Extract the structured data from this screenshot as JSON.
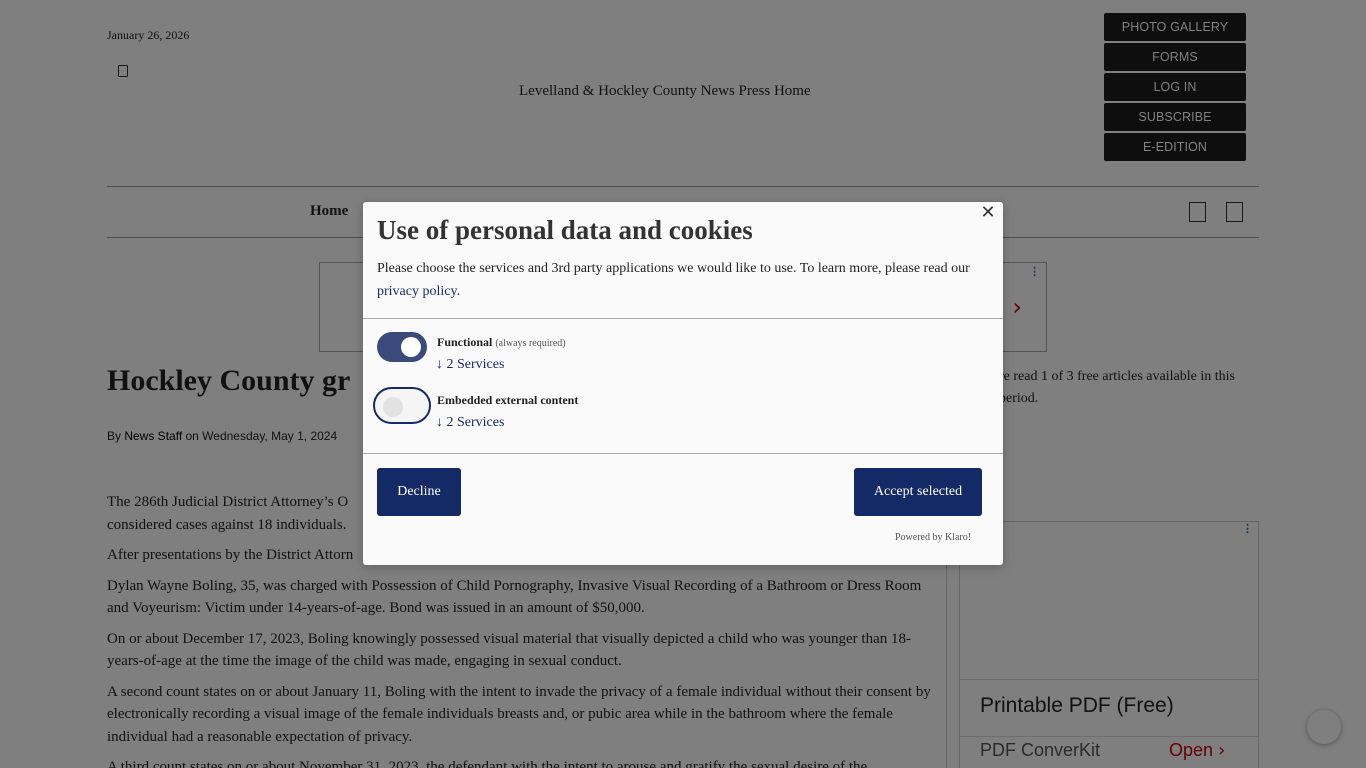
{
  "page": {
    "date": "January 26, 2026",
    "logo_alt": "Levelland & Hockley County News Press Home",
    "top_buttons": [
      "PHOTO GALLERY",
      "FORMS",
      "LOG IN",
      "SUBSCRIBE",
      "E-EDITION"
    ],
    "nav_home": "Home",
    "headline": "Hockley County gr",
    "byline_prefix": "By ",
    "byline_author": "News Staff",
    "byline_date": " on Wednesday, May 1, 2024",
    "free_articles_note": "re read 1 of 3 free articles available in this period.",
    "paragraphs": [
      "The 286th Judicial District Attorney’s O",
      "considered cases against 18 individuals.",
      "After presentations by the District Attorn",
      "Dylan Wayne Boling, 35, was charged with Possession of Child Pornography, Invasive Visual Recording of a Bathroom or Dress Room and Voyeurism: Victim under 14-years-of-age. Bond was issued in an amount of $50,000.",
      "On or about December 17, 2023, Boling knowingly possessed visual material that visually depicted a child who was younger than 18-years-of-age at the time the image of the child was made, engaging in sexual conduct.",
      "A second count states on or about January 11, Boling with the intent to invade the privacy of a female individual without their consent by electronically recording a visual image of the female individuals breasts and, or pubic area while in the bathroom where the female individual had a reasonable expectation of privacy.",
      "A third count states on or about November 31, 2023, the defendant with the intent to arouse and gratify the sexual desire of the"
    ],
    "side_ad": {
      "title": "Printable PDF (Free)",
      "sub": "PDF ConverKit",
      "open": "Open"
    }
  },
  "modal": {
    "title": "Use of personal data and cookies",
    "description": "Please choose the services and 3rd party applications we would like to use. To learn more, please read our ",
    "privacy_link": "privacy policy",
    "description_end": ".",
    "services": [
      {
        "name": "Functional",
        "note": "(always required)",
        "count": "↓ 2 Services",
        "enabled": true
      },
      {
        "name": "Embedded external content",
        "note": "",
        "count": "↓ 2 Services",
        "enabled": false
      }
    ],
    "decline_label": "Decline",
    "accept_label": "Accept selected",
    "powered_by": "Powered by Klaro!",
    "close_icon": "close-icon"
  },
  "colors": {
    "modal_button": "#142a66",
    "toggle_on": "#3a4a7a",
    "link": "#162a6b",
    "overlay": "rgba(0,0,0,0.5)"
  }
}
